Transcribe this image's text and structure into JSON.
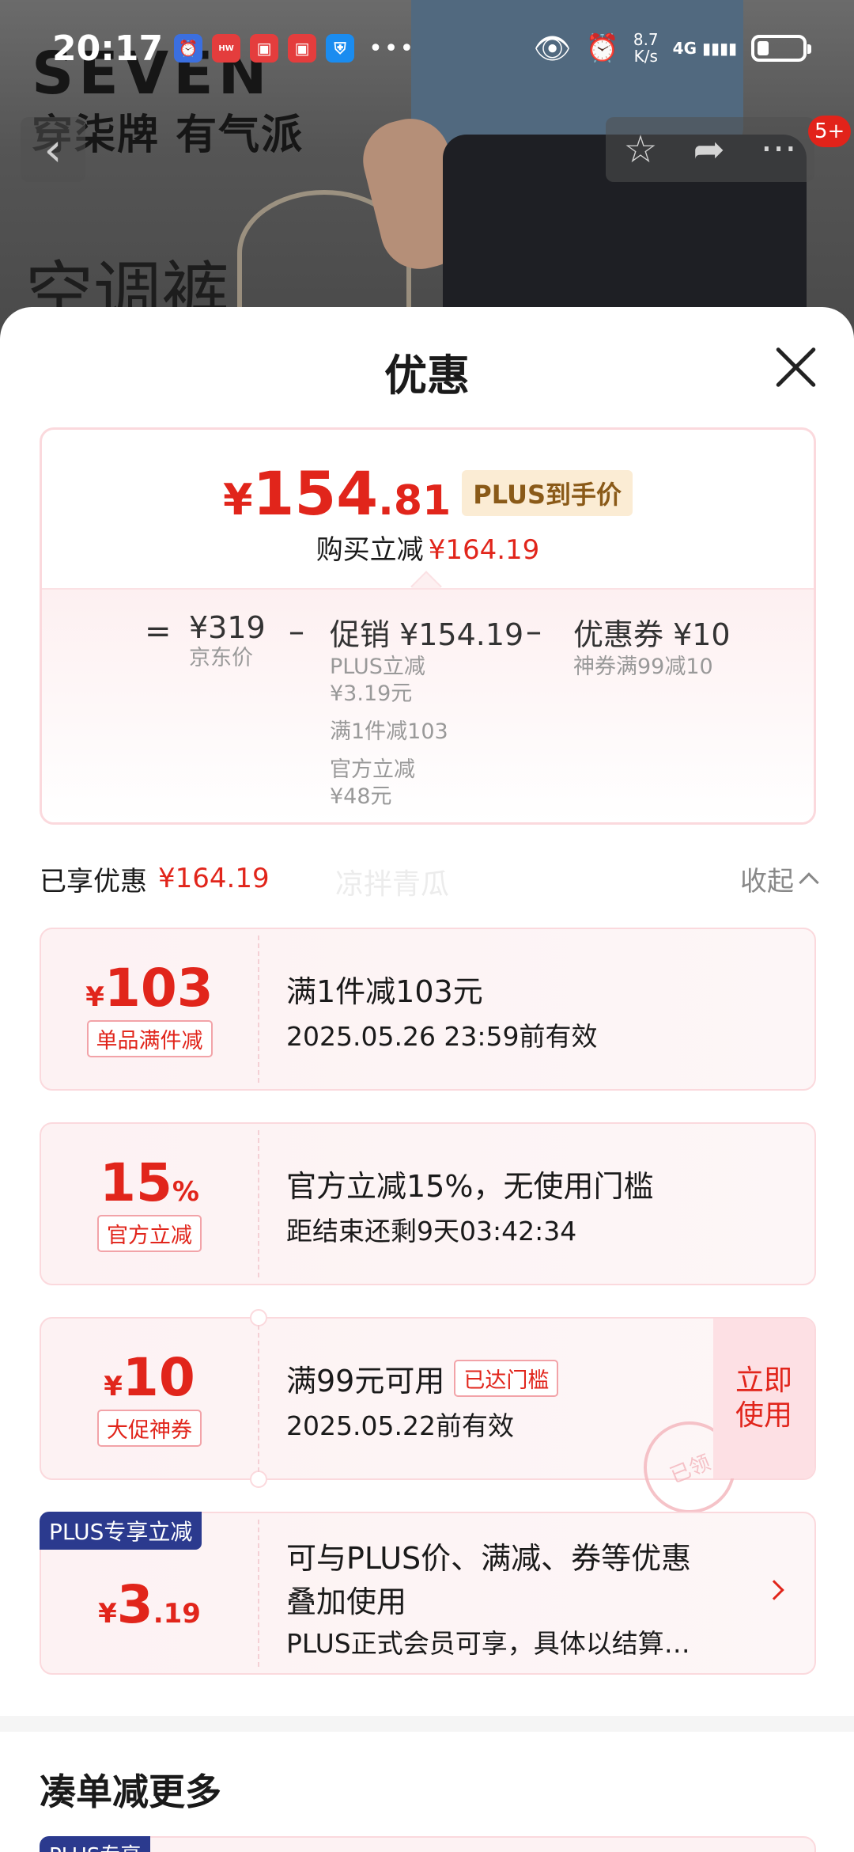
{
  "status_bar": {
    "time": "20:17",
    "speed_value": "8.7",
    "speed_unit": "K/s",
    "network": "4G"
  },
  "banner": {
    "brand": "SEVEN",
    "slogan": "穿柒牌 有气派",
    "product_type": "空调裤",
    "cart_badge": "5+"
  },
  "sheet": {
    "title": "优惠",
    "price": {
      "currency": "¥",
      "integer": "154",
      "decimal": ".81",
      "plus_tag": "PLUS到手价",
      "buy_label": "购买立减",
      "buy_amount": "¥164.19"
    },
    "formula": {
      "eq": "=",
      "minus1": "–",
      "minus2": "–",
      "jd_price": "¥319",
      "jd_label": "京东价",
      "promo_head": "促销 ¥154.19",
      "promo_lines": [
        "PLUS立减",
        "¥3.19元",
        "满1件减103",
        "官方立减",
        "¥48元"
      ],
      "coupon_head": "优惠券 ¥10",
      "coupon_sub": "神券满99减10"
    },
    "saved": {
      "label": "已享优惠",
      "amount": "¥164.19",
      "collapse": "收起",
      "watermark": "凉拌青瓜"
    },
    "coupons": [
      {
        "small": "¥",
        "big": "103",
        "tag": "单品满件减",
        "title": "满1件减103元",
        "sub": "2025.05.26 23:59前有效"
      },
      {
        "big": "15",
        "small": "%",
        "tag": "官方立减",
        "title": "官方立减15%，无使用门槛",
        "sub": "距结束还剩9天03:42:34"
      },
      {
        "small": "¥",
        "big": "10",
        "tag": "大促神券",
        "title": "满99元可用",
        "reached": "已达门槛",
        "sub": "2025.05.22前有效",
        "action_l1": "立即",
        "action_l2": "使用",
        "stamp": "已领"
      },
      {
        "ribbon": "PLUS专享立减",
        "small": "¥",
        "big": "3",
        "decimal": ".19",
        "title_l1": "可与PLUS价、满减、券等优惠",
        "title_l2": "叠加使用",
        "sub": "PLUS正式会员可享，具体以结算…"
      }
    ],
    "more_title": "凑单减更多",
    "peek_ribbon": "PLUS专享"
  },
  "colors": {
    "accent_red": "#e1251b",
    "plus_blue": "#2b3a8e",
    "plus_gold": "#8a5a18"
  }
}
